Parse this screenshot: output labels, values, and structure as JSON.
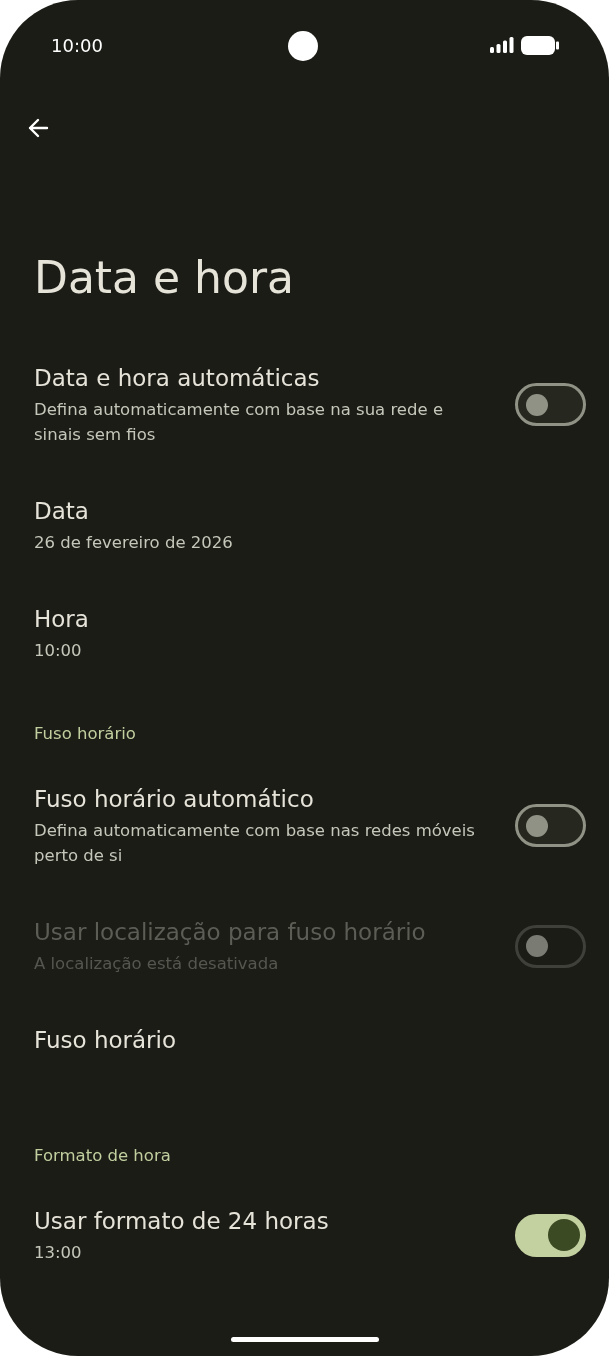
{
  "status_bar": {
    "time": "10:00"
  },
  "title": "Data e hora",
  "items": [
    {
      "kind": "switch",
      "title": "Data e hora automáticas",
      "summary": "Defina automaticamente com base na sua rede e sinais sem fios",
      "on": false,
      "disabled": false
    },
    {
      "kind": "text",
      "title": "Data",
      "summary": "26 de fevereiro de 2026"
    },
    {
      "kind": "text",
      "title": "Hora",
      "summary": "10:00"
    },
    {
      "kind": "header",
      "title": "Fuso horário"
    },
    {
      "kind": "switch",
      "title": "Fuso horário automático",
      "summary": "Defina automaticamente com base nas redes móveis perto de si",
      "on": false,
      "disabled": false
    },
    {
      "kind": "switch",
      "title": "Usar localização para fuso horário",
      "summary": "A localização está desativada",
      "on": false,
      "disabled": true
    },
    {
      "kind": "text",
      "title": "Fuso horário"
    },
    {
      "kind": "header",
      "title": "Formato de hora"
    },
    {
      "kind": "switch",
      "title": "Usar formato de 24 horas",
      "summary": "13:00",
      "on": true,
      "disabled": false
    }
  ]
}
